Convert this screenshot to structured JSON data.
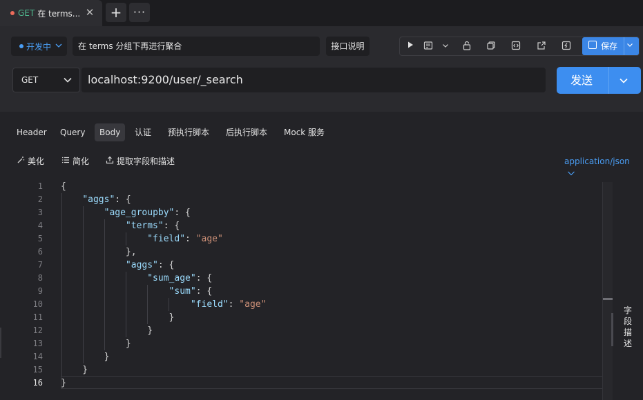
{
  "tab": {
    "method": "GET",
    "title": "在 terms...",
    "close": "✕",
    "new_tab": "+",
    "more": "···"
  },
  "env": {
    "label": "开发中"
  },
  "api": {
    "name": "在 terms 分组下再进行聚合",
    "doc_button": "接口说明",
    "method": "GET",
    "url": "localhost:9200/user/_search",
    "send_label": "发送",
    "save_label": "保存"
  },
  "request_tabs": [
    "Header",
    "Query",
    "Body",
    "认证",
    "预执行脚本",
    "后执行脚本",
    "Mock 服务"
  ],
  "body_tools": {
    "beautify": "美化",
    "simplify": "简化",
    "extract": "提取字段和描述"
  },
  "content_type": "application/json",
  "side_panel": {
    "label": "字段描述"
  },
  "editor": {
    "current_line": 16,
    "lines": [
      "{",
      "    \"aggs\": {",
      "        \"age_groupby\": {",
      "            \"terms\": {",
      "                \"field\": \"age\"",
      "            },",
      "            \"aggs\": {",
      "                \"sum_age\": {",
      "                    \"sum\": {",
      "                        \"field\": \"age\"",
      "                    }",
      "                }",
      "            }",
      "        }",
      "    }",
      "}"
    ]
  },
  "colors": {
    "accent": "#3d8ef0",
    "key": "#9cdcfe",
    "string": "#ce9178",
    "env": "#4a9ef5"
  }
}
